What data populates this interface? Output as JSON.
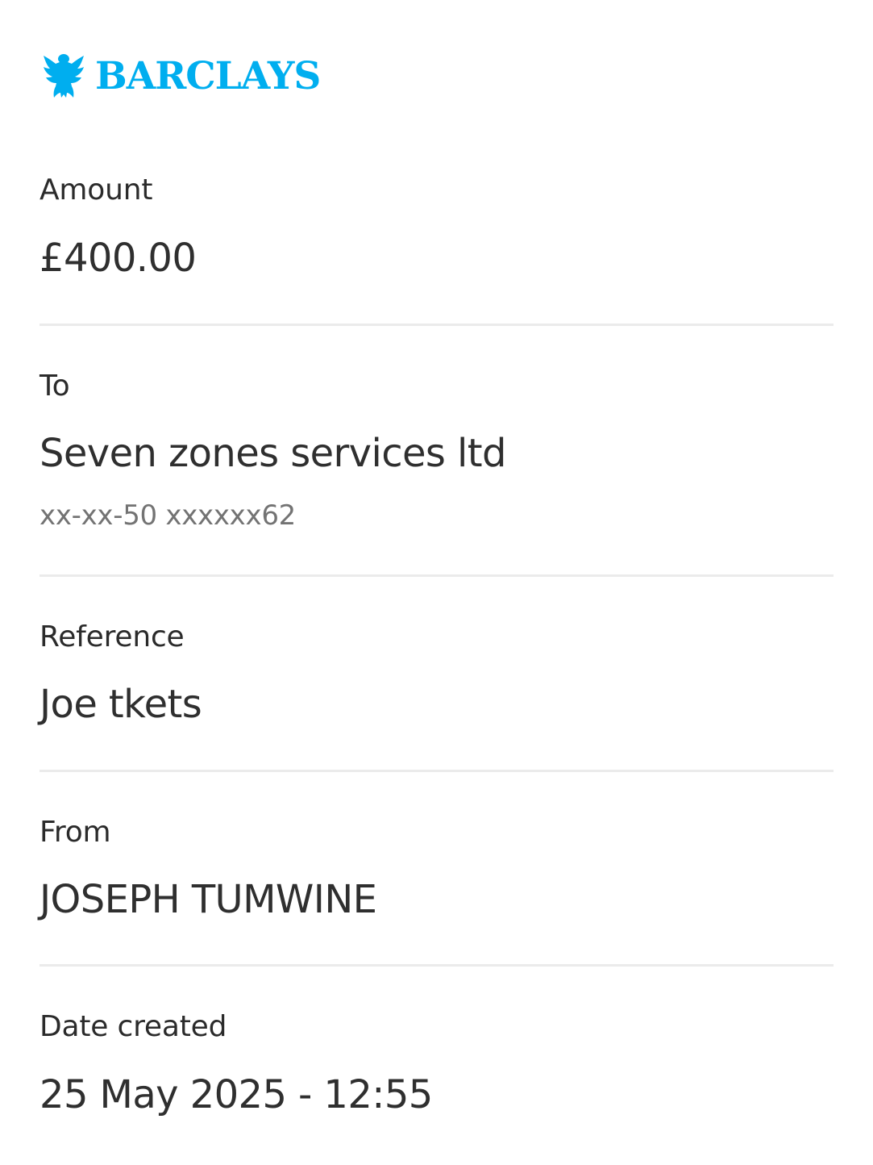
{
  "brand": {
    "name": "BARCLAYS",
    "logo_icon": "eagle-icon",
    "color": "#00aeef"
  },
  "details": {
    "amount": {
      "label": "Amount",
      "value": "£400.00"
    },
    "to": {
      "label": "To",
      "value": "Seven zones services ltd",
      "account": "xx-xx-50 xxxxxx62"
    },
    "reference": {
      "label": "Reference",
      "value": "Joe tkets"
    },
    "from": {
      "label": "From",
      "value": "JOSEPH TUMWINE"
    },
    "date_created": {
      "label": "Date created",
      "value": "25 May 2025 - 12:55"
    }
  }
}
